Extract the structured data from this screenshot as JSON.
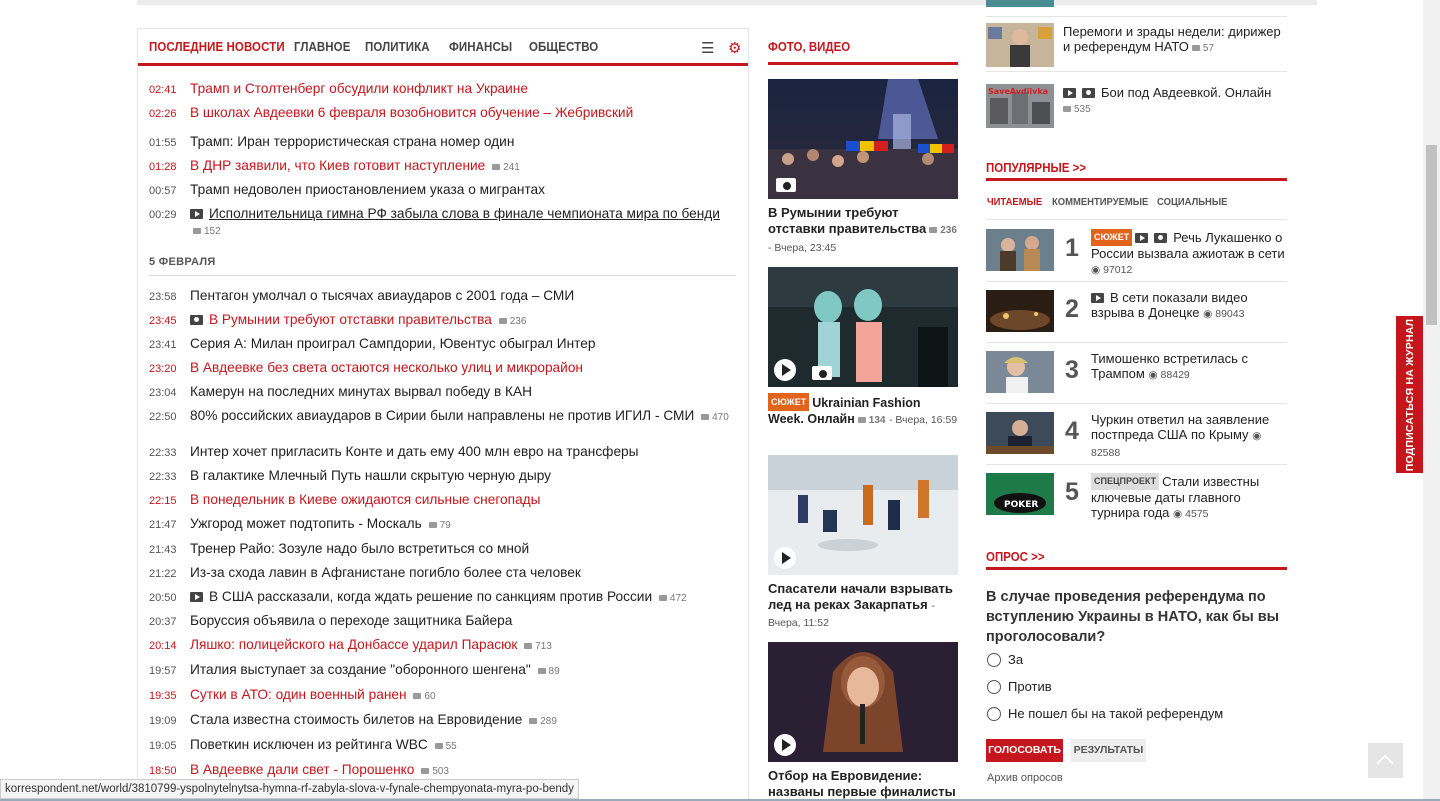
{
  "news_tabs": [
    "ПОСЛЕДНИЕ НОВОСТИ",
    "ГЛАВНОЕ",
    "ПОЛИТИКА",
    "ФИНАНСЫ",
    "ОБЩЕСТВО"
  ],
  "news_today": [
    {
      "time": "02:41",
      "title": "Трамп и Столтенберг обсудили конфликт на Украине",
      "red": true
    },
    {
      "time": "02:26",
      "title": "В школах Авдеевки 6 февраля возобновится обучение – Жебривский",
      "red": true
    },
    {
      "time": "01:55",
      "title": "Трамп: Иран террористическая страна номер один"
    },
    {
      "time": "01:28",
      "title": "В ДНР заявили, что Киев готовит наступление",
      "comments": "241",
      "red": true
    },
    {
      "time": "00:57",
      "title": "Трамп недоволен приостановлением указа о мигрантах"
    },
    {
      "time": "00:29",
      "title": "Исполнительница гимна РФ забыла слова в финале чемпионата мира по бенди",
      "comments": "152",
      "video": true,
      "underline": true
    }
  ],
  "date_heading": "5 ФЕВРАЛЯ",
  "news_feb5": [
    {
      "time": "23:58",
      "title": "Пентагон умолчал о тысячах авиаударов с 2001 года – СМИ"
    },
    {
      "time": "23:45",
      "title": "В Румынии требуют отставки правительства",
      "comments": "236",
      "photo": true,
      "red": true
    },
    {
      "time": "23:41",
      "title": "Серия А: Милан проиграл Сампдории, Ювентус обыграл Интер"
    },
    {
      "time": "23:20",
      "title": "В Авдеевке без света остаются несколько улиц и микрорайон",
      "red": true
    },
    {
      "time": "23:04",
      "title": "Камерун на последних минутах вырвал победу в КАН"
    },
    {
      "time": "22:50",
      "title": "80% российских авиаударов в Сирии были направлены не против ИГИЛ - СМИ",
      "comments": "470"
    },
    {
      "time": "22:33",
      "title": "Интер хочет пригласить Конте и дать ему 400 млн евро на трансферы"
    },
    {
      "time": "22:33",
      "title": "В галактике Млечный Путь нашли скрытую черную дыру"
    },
    {
      "time": "22:15",
      "title": "В понедельник в Киеве ожидаются сильные снегопады",
      "red": true
    },
    {
      "time": "21:47",
      "title": "Ужгород может подтопить - Москаль",
      "comments": "79"
    },
    {
      "time": "21:43",
      "title": "Тренер Райо: Зозуле надо было встретиться со мной"
    },
    {
      "time": "21:22",
      "title": "Из-за схода лавин в Афганистане погибло более ста человек"
    },
    {
      "time": "20:50",
      "title": "В США рассказали, когда ждать решение по санкциям против России",
      "comments": "472",
      "video": true
    },
    {
      "time": "20:37",
      "title": "Боруссия объявила о переходе защитника Байера"
    },
    {
      "time": "20:14",
      "title": "Ляшко: полицейского на Донбассе ударил Парасюк",
      "comments": "713",
      "red": true
    },
    {
      "time": "19:57",
      "title": "Италия выступает за создание \"оборонного шенгена\"",
      "comments": "89"
    },
    {
      "time": "19:35",
      "title": "Сутки в АТО: один военный ранен",
      "comments": "60",
      "red": true
    },
    {
      "time": "19:09",
      "title": "Стала известна стоимость билетов на Евровидение",
      "comments": "289"
    },
    {
      "time": "19:05",
      "title": "Поветкин исключен из рейтинга WBC",
      "comments": "55"
    },
    {
      "time": "18:50",
      "title": "В Авдеевке дали свет - Порошенко",
      "comments": "503",
      "red": true
    }
  ],
  "media": {
    "heading": "ФОТО, ВИДЕО",
    "cards": [
      {
        "title": "В Румынии требуют отставки правительства",
        "comments": "236",
        "meta": "- Вчера, 23:45"
      },
      {
        "badge": "СЮЖЕТ",
        "title": "Ukrainian Fashion Week. Онлайн",
        "comments": "134",
        "meta": "- Вчера, 16:59"
      },
      {
        "title": "Спасатели начали взрывать лед на реках Закарпатья",
        "meta": "- Вчера, 11:52"
      },
      {
        "title": "Отбор на Евровидение: названы первые финалисты"
      }
    ]
  },
  "right_top": [
    {
      "title": "Перемоги и зрады недели: дирижер и референдум НАТО",
      "comments": "57"
    },
    {
      "title": "Бои под Авдеевкой. Онлайн",
      "comments": "535",
      "thumb_text": "SaveAvdiivka"
    }
  ],
  "popular": {
    "heading": "ПОПУЛЯРНЫЕ >>",
    "tabs": [
      "ЧИТАЕМЫЕ",
      "КОММЕНТИРУЕМЫЕ",
      "СОЦИАЛЬНЫЕ"
    ],
    "items": [
      {
        "num": "1",
        "badge": "СЮЖЕТ",
        "title": "Речь Лукашенко о России вызвала ажиотаж в сети",
        "views": "97012"
      },
      {
        "num": "2",
        "title": "В сети показали видео взрыва в Донецке",
        "views": "89043"
      },
      {
        "num": "3",
        "title": "Тимошенко встретилась с Трампом",
        "views": "88429"
      },
      {
        "num": "4",
        "title": "Чуркин ответил на заявление постпреда США по Крыму",
        "views": "82588"
      },
      {
        "num": "5",
        "badge": "СПЕЦПРОЕКТ",
        "title": "Стали известны ключевые даты главного турнира года",
        "views": "4575",
        "thumb_text": "POKER"
      }
    ]
  },
  "poll": {
    "heading": "ОПРОС >>",
    "question": "В случае проведения референдума по вступлению Украины в НАТО, как бы вы проголосовали?",
    "options": [
      "За",
      "Против",
      "Не пошел бы на такой референдум"
    ],
    "vote_label": "ГОЛОСОВАТЬ",
    "results_label": "РЕЗУЛЬТАТЫ",
    "archive_label": "Архив опросов"
  },
  "subscribe_label": "ПОДПИСАТЬСЯ НА ЖУРНАЛ",
  "status_url": "korrespondent.net/world/3810799-yspolnytelnytsa-hymna-rf-zabyla-slova-v-fynale-chempyonata-myra-po-bendy",
  "colors": {
    "accent": "#c4161c",
    "badge_orange": "#e2631b"
  }
}
